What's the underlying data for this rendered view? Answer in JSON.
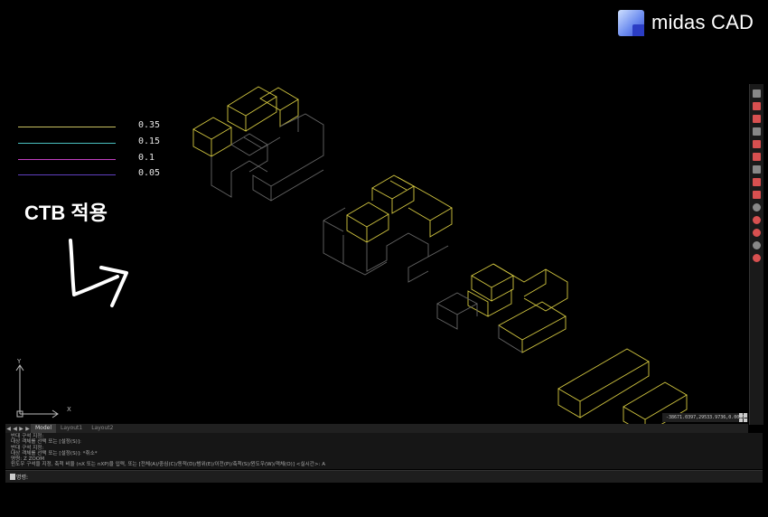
{
  "brand": {
    "name": "midas CAD"
  },
  "annotation": {
    "label": "CTB 적용"
  },
  "legend": [
    {
      "value": "0.35",
      "color": "#c8c060"
    },
    {
      "value": "0.15",
      "color": "#4ac0c0"
    },
    {
      "value": "0.1",
      "color": "#c040c0"
    },
    {
      "value": "0.05",
      "color": "#6040c0"
    }
  ],
  "ucs": {
    "x_label": "X",
    "y_label": "Y"
  },
  "tabs": {
    "nav": [
      "◀",
      "◀",
      "▶",
      "▶"
    ],
    "items": [
      {
        "label": "Model",
        "active": true
      },
      {
        "label": "Layout1",
        "active": false
      },
      {
        "label": "Layout2",
        "active": false
      }
    ]
  },
  "status": {
    "coordinates": "-38671.0397,29533.9736,0.0000"
  },
  "command_history": [
    "반대 구석 지정:",
    "대상 객체를 선택 또는 [설정(S)]:",
    "반대 구석 지정:",
    "대상 객체를 선택 또는 [설정(S)]: *취소*",
    "명령: Z ZOOM",
    "윈도우 구석을 지정, 축척 비율 (nX 또는 nXP)을 입력, 또는 [전체(A)/중심(C)/동적(D)/범위(E)/이전(P)/축척(S)/윈도우(W)/객체(O)] <실시간>: A"
  ],
  "command_prompt": "명령:",
  "colors": {
    "drawing_line": "#d4c840",
    "background": "#000000",
    "toolbar_icon": "#d85050"
  }
}
